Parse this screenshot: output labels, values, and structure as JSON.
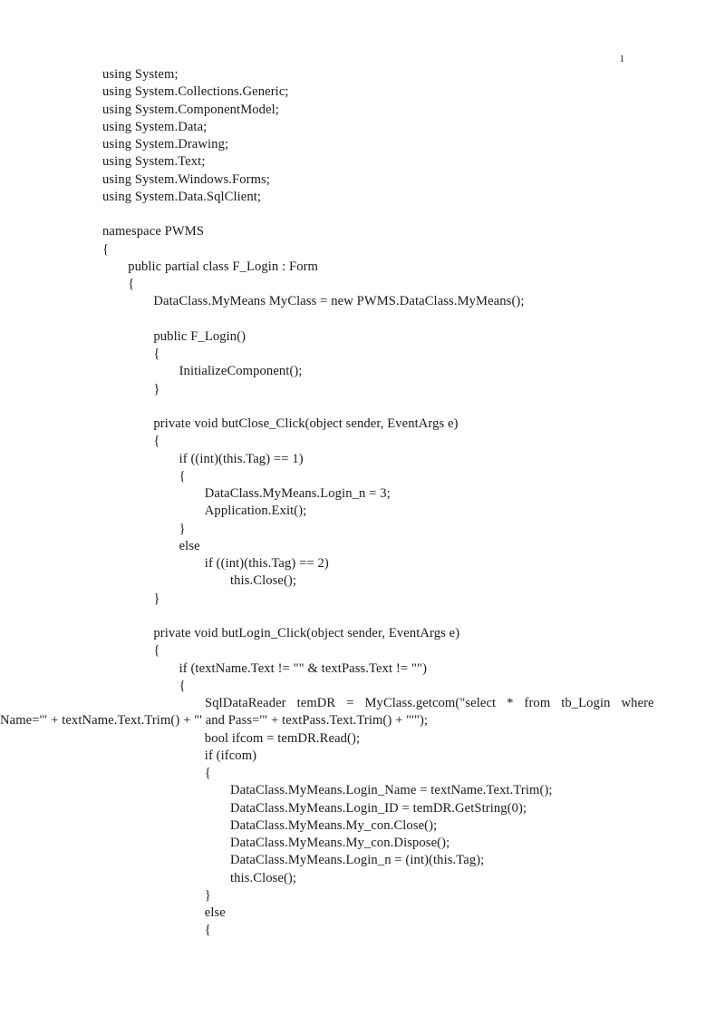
{
  "document": {
    "page_number": "1",
    "language": "C#",
    "indent_unit": "    "
  },
  "code": {
    "lines": [
      {
        "indent": 0,
        "text": "using System;"
      },
      {
        "indent": 0,
        "text": "using System.Collections.Generic;"
      },
      {
        "indent": 0,
        "text": "using System.ComponentModel;"
      },
      {
        "indent": 0,
        "text": "using System.Data;"
      },
      {
        "indent": 0,
        "text": "using System.Drawing;"
      },
      {
        "indent": 0,
        "text": "using System.Text;"
      },
      {
        "indent": 0,
        "text": "using System.Windows.Forms;"
      },
      {
        "indent": 0,
        "text": "using System.Data.SqlClient;"
      },
      {
        "indent": 0,
        "text": ""
      },
      {
        "indent": 0,
        "text": "namespace PWMS"
      },
      {
        "indent": 0,
        "text": "{"
      },
      {
        "indent": 1,
        "text": "public partial class F_Login : Form"
      },
      {
        "indent": 1,
        "text": "{"
      },
      {
        "indent": 2,
        "text": "DataClass.MyMeans MyClass = new PWMS.DataClass.MyMeans();"
      },
      {
        "indent": 2,
        "text": ""
      },
      {
        "indent": 2,
        "text": "public F_Login()"
      },
      {
        "indent": 2,
        "text": "{"
      },
      {
        "indent": 3,
        "text": "InitializeComponent();"
      },
      {
        "indent": 2,
        "text": "}"
      },
      {
        "indent": 2,
        "text": ""
      },
      {
        "indent": 2,
        "text": "private void butClose_Click(object sender, EventArgs e)"
      },
      {
        "indent": 2,
        "text": "{"
      },
      {
        "indent": 3,
        "text": "if ((int)(this.Tag) == 1)"
      },
      {
        "indent": 3,
        "text": "{"
      },
      {
        "indent": 4,
        "text": "DataClass.MyMeans.Login_n = 3;"
      },
      {
        "indent": 4,
        "text": "Application.Exit();"
      },
      {
        "indent": 3,
        "text": "}"
      },
      {
        "indent": 3,
        "text": "else"
      },
      {
        "indent": 4,
        "text": "if ((int)(this.Tag) == 2)"
      },
      {
        "indent": 5,
        "text": "this.Close();"
      },
      {
        "indent": 2,
        "text": "}"
      },
      {
        "indent": 2,
        "text": ""
      },
      {
        "indent": 2,
        "text": "private void butLogin_Click(object sender, EventArgs e)"
      },
      {
        "indent": 2,
        "text": "{"
      },
      {
        "indent": 3,
        "text": "if (textName.Text != \"\" & textPass.Text != \"\")"
      },
      {
        "indent": 3,
        "text": "{"
      }
    ],
    "justified_statement": {
      "row1": "SqlDataReader temDR = MyClass.getcom(\"select * from tb_Login where",
      "row2": "Name='\" + textName.Text.Trim() + \"' and Pass='\" + textPass.Text.Trim() + \"'\");",
      "full_text": "SqlDataReader temDR = MyClass.getcom(\"select * from tb_Login where Name='\" + textName.Text.Trim() + \"' and Pass='\" + textPass.Text.Trim() + \"'\");"
    },
    "lines_after": [
      {
        "indent": 4,
        "text": "bool ifcom = temDR.Read();"
      },
      {
        "indent": 4,
        "text": "if (ifcom)"
      },
      {
        "indent": 4,
        "text": "{"
      },
      {
        "indent": 5,
        "text": "DataClass.MyMeans.Login_Name = textName.Text.Trim();"
      },
      {
        "indent": 5,
        "text": "DataClass.MyMeans.Login_ID = temDR.GetString(0);"
      },
      {
        "indent": 5,
        "text": "DataClass.MyMeans.My_con.Close();"
      },
      {
        "indent": 5,
        "text": "DataClass.MyMeans.My_con.Dispose();"
      },
      {
        "indent": 5,
        "text": "DataClass.MyMeans.Login_n = (int)(this.Tag);"
      },
      {
        "indent": 5,
        "text": "this.Close();"
      },
      {
        "indent": 4,
        "text": "}"
      },
      {
        "indent": 4,
        "text": "else"
      },
      {
        "indent": 4,
        "text": "{"
      }
    ]
  }
}
